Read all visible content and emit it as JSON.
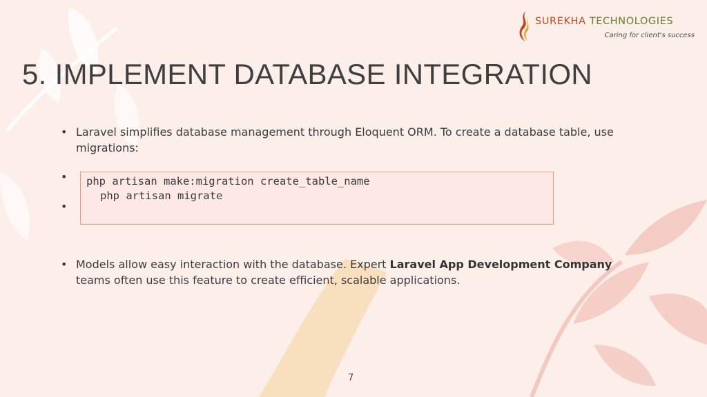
{
  "logo": {
    "name_part1": "SUREKHA",
    "name_part2": "TECHNOLOGIES",
    "tagline": "Caring for client's success",
    "colors": {
      "primary": "#c2451e",
      "secondary": "#6a7a2c"
    }
  },
  "title": "5. IMPLEMENT DATABASE INTEGRATION",
  "bullets": {
    "first": "Laravel simplifies database management through Eloquent ORM. To create a database table, use migrations:",
    "second_pre": "Models allow easy interaction with the database. Expert ",
    "second_bold": "Laravel App Development Company",
    "second_post": " teams often use this feature to create efficient, scalable applications.",
    "marker": "•"
  },
  "code": {
    "line1": "php artisan make:migration create_table_name",
    "line2": "php artisan migrate"
  },
  "page_number": "7",
  "colors": {
    "background": "#fcefea",
    "code_bg": "#fde8e6",
    "code_border": "#ec9a82"
  }
}
